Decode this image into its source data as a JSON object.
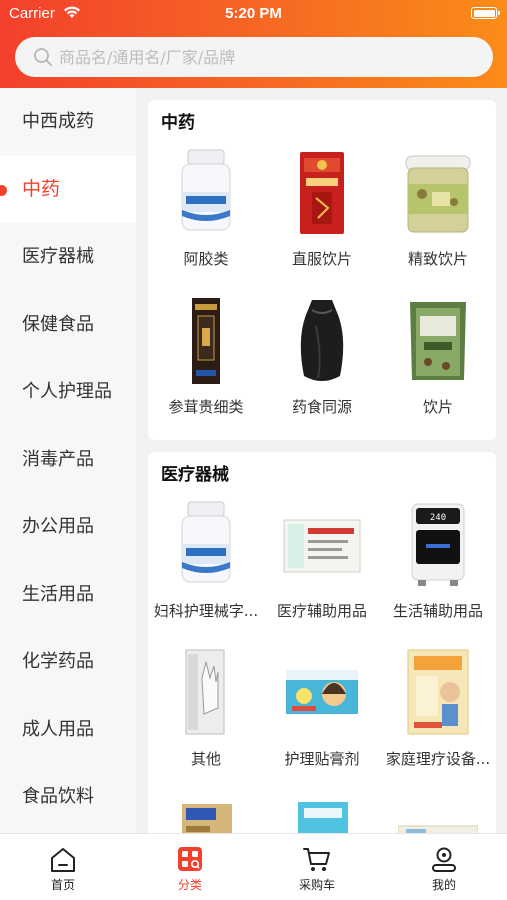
{
  "status_bar": {
    "carrier": "Carrier",
    "time": "5:20 PM"
  },
  "search": {
    "placeholder": "商品名/通用名/厂家/品牌"
  },
  "sidebar": {
    "items": [
      {
        "label": "中西成药"
      },
      {
        "label": "中药"
      },
      {
        "label": "医疗器械"
      },
      {
        "label": "保健食品"
      },
      {
        "label": "个人护理品"
      },
      {
        "label": "消毒产品"
      },
      {
        "label": "办公用品"
      },
      {
        "label": "生活用品"
      },
      {
        "label": "化学药品"
      },
      {
        "label": "成人用品"
      },
      {
        "label": "食品饮料"
      }
    ],
    "active_index": 1
  },
  "sections": [
    {
      "title": "中药",
      "items": [
        {
          "name": "阿胶类",
          "icon": "medicine-bottle"
        },
        {
          "name": "直服饮片",
          "icon": "red-box"
        },
        {
          "name": "精致饮片",
          "icon": "herb-jar"
        },
        {
          "name": "参茸贵细类",
          "icon": "gift-box"
        },
        {
          "name": "药食同源",
          "icon": "black-pouch"
        },
        {
          "name": "饮片",
          "icon": "herb-bag"
        }
      ]
    },
    {
      "title": "医疗器械",
      "items": [
        {
          "name": "妇科护理械字...",
          "icon": "medicine-bottle"
        },
        {
          "name": "医疗辅助用品",
          "icon": "bandage-pack"
        },
        {
          "name": "生活辅助用品",
          "icon": "device"
        },
        {
          "name": "其他",
          "icon": "glove-pack"
        },
        {
          "name": "护理贴膏剂",
          "icon": "patch-box"
        },
        {
          "name": "家庭理疗设备...",
          "icon": "heat-patch"
        }
      ]
    }
  ],
  "tabbar": {
    "items": [
      {
        "label": "首页"
      },
      {
        "label": "分类"
      },
      {
        "label": "采购车"
      },
      {
        "label": "我的"
      }
    ],
    "active_index": 1
  },
  "colors": {
    "brand": "#f4402c",
    "header_end": "#fb8c18"
  }
}
